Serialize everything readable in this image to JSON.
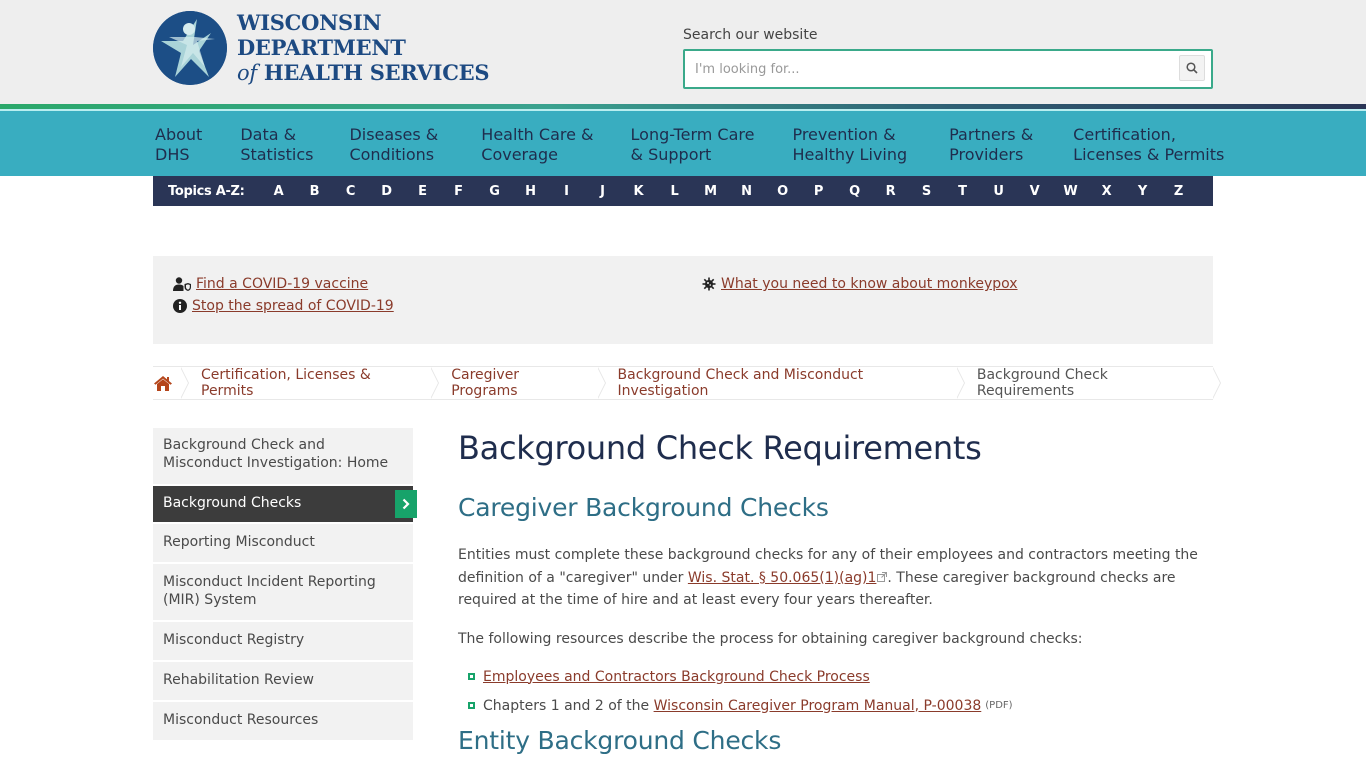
{
  "header": {
    "logo_line1": "WISCONSIN DEPARTMENT",
    "logo_line2_italic": "of",
    "logo_line2": " HEALTH SERVICES",
    "search_label": "Search our website",
    "search_placeholder": "I'm looking for...",
    "search_value": "",
    "search_icon": "search-icon"
  },
  "nav": {
    "items": [
      {
        "line1": "About",
        "line2": "DHS"
      },
      {
        "line1": "Data &",
        "line2": "Statistics"
      },
      {
        "line1": "Diseases &",
        "line2": "Conditions"
      },
      {
        "line1": "Health Care &",
        "line2": "Coverage"
      },
      {
        "line1": "Long-Term Care",
        "line2": "& Support"
      },
      {
        "line1": "Prevention &",
        "line2": "Healthy Living"
      },
      {
        "line1": "Partners &",
        "line2": "Providers"
      },
      {
        "line1": "Certification,",
        "line2": "Licenses & Permits"
      }
    ]
  },
  "az": {
    "label": "Topics A-Z:",
    "letters": [
      "A",
      "B",
      "C",
      "D",
      "E",
      "F",
      "G",
      "H",
      "I",
      "J",
      "K",
      "L",
      "M",
      "N",
      "O",
      "P",
      "Q",
      "R",
      "S",
      "T",
      "U",
      "V",
      "W",
      "X",
      "Y",
      "Z"
    ]
  },
  "alerts": {
    "vaccine": {
      "text": "Find a COVID-19 vaccine",
      "icon": "user-shield-icon"
    },
    "spread": {
      "text": "Stop the spread of COVID-19",
      "icon": "info-circle-icon"
    },
    "monkeypox": {
      "text": "What you need to know about monkeypox",
      "icon": "virus-icon"
    }
  },
  "breadcrumb": {
    "home_icon": "home-icon",
    "items": [
      "Certification, Licenses & Permits",
      "Caregiver Programs",
      "Background Check and Misconduct Investigation"
    ],
    "current": "Background Check Requirements"
  },
  "sidebar": {
    "items": [
      {
        "label": "Background Check and Misconduct Investigation: Home",
        "active": false
      },
      {
        "label": "Background Checks",
        "active": true
      },
      {
        "label": "Reporting Misconduct",
        "active": false
      },
      {
        "label": "Misconduct Incident Reporting (MIR) System",
        "active": false
      },
      {
        "label": "Misconduct Registry",
        "active": false
      },
      {
        "label": "Rehabilitation Review",
        "active": false
      },
      {
        "label": "Misconduct Resources",
        "active": false
      }
    ]
  },
  "content": {
    "title": "Background Check Requirements",
    "section1_heading": "Caregiver Background Checks",
    "para1_before": "Entities must complete these background checks for any of their employees and contractors meeting the definition of a \"caregiver\" under ",
    "para1_link": "Wis. Stat. § 50.065(1)(ag)1",
    "para1_after": ". These caregiver background checks are required at the time of hire and at least every four years thereafter.",
    "para2": "The following resources describe the process for obtaining caregiver background checks:",
    "list": {
      "item1_link": "Employees and Contractors Background Check Process",
      "item2_before": "Chapters 1 and 2 of the ",
      "item2_link": "Wisconsin Caregiver Program Manual, P-00038",
      "item2_badge": "(PDF)"
    },
    "section2_heading": "Entity Background Checks"
  },
  "colors": {
    "nav_bg": "#39adc0",
    "az_bg": "#2a3556",
    "accent_green": "#17a36a",
    "link": "#8a3b2b",
    "title": "#1f2d4d",
    "heading": "#2e6e86"
  }
}
